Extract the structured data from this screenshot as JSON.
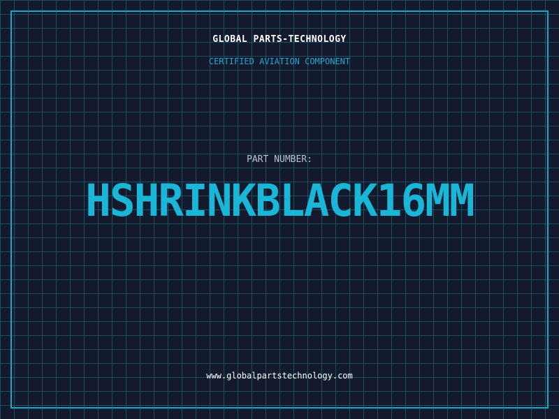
{
  "header": {
    "brand": "GLOBAL PARTS-TECHNOLOGY",
    "subtitle": "CERTIFIED AVIATION COMPONENT"
  },
  "part": {
    "label": "PART NUMBER:",
    "number": "HSHRINKBLACK16MM"
  },
  "footer": {
    "url": "www.globalpartstechnology.com"
  },
  "colors": {
    "background": "#131a2e",
    "grid": "#22788c",
    "accent": "#1aa7c8",
    "text": "#ffffff",
    "label": "#b8c2cf"
  }
}
